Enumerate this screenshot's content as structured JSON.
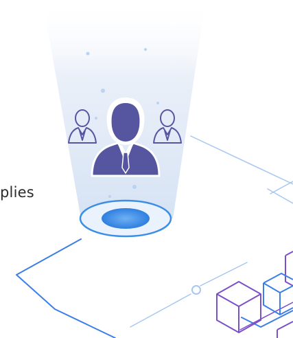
{
  "partial_text": "plies",
  "icons": {
    "main": "businessman-icon",
    "left": "person-outline-icon",
    "right": "person-outline-icon",
    "portal": "ellipse-portal-icon",
    "blocks": "cube-network-icon"
  },
  "colors": {
    "person_fill": "#55569f",
    "line_blue": "#3b7ee8",
    "line_light": "#8fb8ef",
    "cube_purple": "#7a4fc9",
    "portal_blue": "#3b8de6"
  }
}
